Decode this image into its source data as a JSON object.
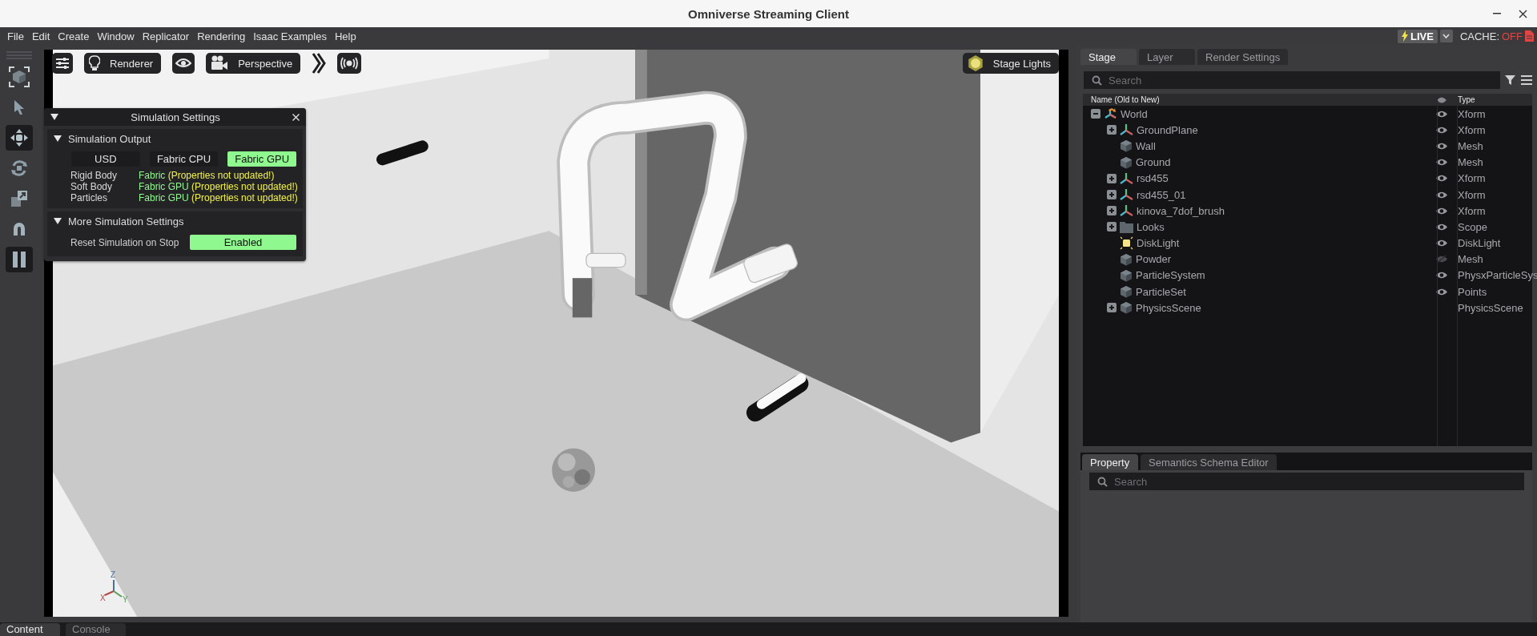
{
  "window": {
    "title": "Omniverse Streaming Client"
  },
  "menu": [
    "File",
    "Edit",
    "Create",
    "Window",
    "Replicator",
    "Rendering",
    "Isaac Examples",
    "Help"
  ],
  "status": {
    "live": "LIVE",
    "cache_label": "CACHE:",
    "cache_value": "OFF"
  },
  "tools": [
    {
      "kind": "frame",
      "selected": false
    },
    {
      "kind": "select",
      "selected": false
    },
    {
      "kind": "move",
      "selected": true
    },
    {
      "kind": "rotate",
      "selected": false
    },
    {
      "kind": "scale",
      "selected": false
    },
    {
      "kind": "snap",
      "selected": false
    },
    {
      "kind": "pause",
      "selected": true
    }
  ],
  "viewport": {
    "toolbar": [
      {
        "kind": "settings"
      },
      {
        "kind": "renderer",
        "label": "Renderer"
      },
      {
        "kind": "eye"
      },
      {
        "kind": "camera",
        "label": "Perspective"
      },
      {
        "kind": "more"
      },
      {
        "kind": "broadcast"
      }
    ],
    "stage_lights": "Stage Lights",
    "axis_labels": [
      "Z",
      "X",
      "Y"
    ]
  },
  "simulation_settings": {
    "title": "Simulation Settings",
    "expanded": true,
    "output": {
      "title": "Simulation Output",
      "expanded": true,
      "options": [
        {
          "label": "USD",
          "selected": false
        },
        {
          "label": "Fabric CPU",
          "selected": false
        },
        {
          "label": "Fabric GPU",
          "selected": true
        }
      ],
      "rows": [
        {
          "label": "Rigid Body",
          "backend": "Fabric",
          "note": "(Properties not updated!)"
        },
        {
          "label": "Soft Body",
          "backend": "Fabric GPU",
          "note": "(Properties not updated!)"
        },
        {
          "label": "Particles",
          "backend": "Fabric GPU",
          "note": "(Properties not updated!)"
        }
      ]
    },
    "more": {
      "title": "More Simulation Settings",
      "expanded": true,
      "reset_label": "Reset Simulation on Stop",
      "reset_value": "Enabled",
      "reset_on": true
    }
  },
  "stage": {
    "tabs": [
      {
        "label": "Stage",
        "selected": true
      },
      {
        "label": "Layer",
        "selected": false
      },
      {
        "label": "Render Settings",
        "selected": false
      }
    ],
    "search": {
      "placeholder": "Search"
    },
    "columns": {
      "name": "Name (Old to New)",
      "type": "Type"
    },
    "tree": [
      {
        "name": "World",
        "type": "Xform",
        "kind": "root",
        "visible": true,
        "toggleable": true,
        "expandable": true,
        "expanded": true,
        "children": [
          {
            "name": "GroundPlane",
            "type": "Xform",
            "kind": "xform",
            "visible": true,
            "toggleable": true,
            "expandable": true,
            "expanded": false
          },
          {
            "name": "Wall",
            "type": "Mesh",
            "kind": "mesh",
            "visible": true,
            "toggleable": true,
            "expandable": false,
            "expanded": false
          },
          {
            "name": "Ground",
            "type": "Mesh",
            "kind": "mesh",
            "visible": true,
            "toggleable": true,
            "expandable": false,
            "expanded": false
          },
          {
            "name": "rsd455",
            "type": "Xform",
            "kind": "xform",
            "visible": true,
            "toggleable": true,
            "expandable": true,
            "expanded": false
          },
          {
            "name": "rsd455_01",
            "type": "Xform",
            "kind": "xform",
            "visible": true,
            "toggleable": true,
            "expandable": true,
            "expanded": false
          },
          {
            "name": "kinova_7dof_brush",
            "type": "Xform",
            "kind": "xform",
            "visible": true,
            "toggleable": true,
            "expandable": true,
            "expanded": false
          },
          {
            "name": "Looks",
            "type": "Scope",
            "kind": "folder",
            "visible": true,
            "toggleable": true,
            "expandable": true,
            "expanded": false
          },
          {
            "name": "DiskLight",
            "type": "DiskLight",
            "kind": "light",
            "visible": true,
            "toggleable": true,
            "expandable": false,
            "expanded": false
          },
          {
            "name": "Powder",
            "type": "Mesh",
            "kind": "mesh",
            "visible": false,
            "toggleable": true,
            "expandable": false,
            "expanded": false
          },
          {
            "name": "ParticleSystem",
            "type": "PhysxParticleSys",
            "kind": "mesh",
            "visible": true,
            "toggleable": true,
            "expandable": false,
            "expanded": false
          },
          {
            "name": "ParticleSet",
            "type": "Points",
            "kind": "mesh",
            "visible": true,
            "toggleable": true,
            "expandable": false,
            "expanded": false
          },
          {
            "name": "PhysicsScene",
            "type": "PhysicsScene",
            "kind": "mesh",
            "toggleable": false,
            "expandable": true,
            "expanded": false
          }
        ]
      }
    ]
  },
  "property": {
    "tabs": [
      {
        "label": "Property",
        "selected": true
      },
      {
        "label": "Semantics Schema Editor",
        "selected": false
      }
    ],
    "search": {
      "placeholder": "Search"
    }
  },
  "bottom_tabs": [
    {
      "label": "Content",
      "selected": true
    },
    {
      "label": "Console",
      "selected": false
    }
  ]
}
